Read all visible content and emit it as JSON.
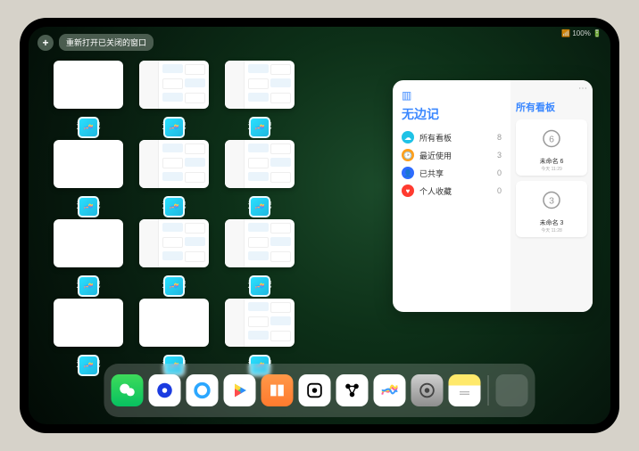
{
  "status_text": "📶 100% 🔋",
  "buttons": {
    "plus": "+",
    "reopen": "重新打开已关闭的窗口"
  },
  "app_name": "无边记",
  "windows": [
    {
      "label": "无边记",
      "style": "blank"
    },
    {
      "label": "无边记",
      "style": "grid"
    },
    {
      "label": "无边记",
      "style": "grid"
    },
    {
      "label": "无边记",
      "style": "blank"
    },
    {
      "label": "无边记",
      "style": "grid"
    },
    {
      "label": "无边记",
      "style": "grid"
    },
    {
      "label": "无边记",
      "style": "blank"
    },
    {
      "label": "无边记",
      "style": "grid"
    },
    {
      "label": "无边记",
      "style": "grid"
    },
    {
      "label": "无边记",
      "style": "blank"
    },
    {
      "label": "无边记",
      "style": "blank"
    },
    {
      "label": "无边记",
      "style": "grid"
    }
  ],
  "sidepanel": {
    "title": "无边记",
    "right_title": "所有看板",
    "items": [
      {
        "icon_color": "#1fc2e6",
        "label": "所有看板",
        "count": 8
      },
      {
        "icon_color": "#ff9f1c",
        "label": "最近使用",
        "count": 3
      },
      {
        "icon_color": "#2e6cff",
        "label": "已共享",
        "count": 0
      },
      {
        "icon_color": "#ff3b30",
        "label": "个人收藏",
        "count": 0
      }
    ],
    "boards": [
      {
        "label": "未命名 6",
        "date": "今天 11:29",
        "digit": "6"
      },
      {
        "label": "未命名 3",
        "date": "今天 11:28",
        "digit": "3"
      }
    ]
  },
  "dock": [
    {
      "name": "wechat",
      "bg": "linear-gradient(180deg,#3ddb5a,#07c160)"
    },
    {
      "name": "app-blue-circle",
      "bg": "#fff"
    },
    {
      "name": "quark",
      "bg": "#fff"
    },
    {
      "name": "play",
      "bg": "#fff"
    },
    {
      "name": "books",
      "bg": "linear-gradient(180deg,#ff9848,#ff7a2e)"
    },
    {
      "name": "dice",
      "bg": "#fff"
    },
    {
      "name": "nodes",
      "bg": "#fff"
    },
    {
      "name": "freeform",
      "bg": "#fff"
    },
    {
      "name": "settings",
      "bg": "linear-gradient(180deg,#cfcfcf,#8e8e8e)"
    },
    {
      "name": "notes",
      "bg": "linear-gradient(180deg,#ffe96b 35%,#fff 35%)"
    }
  ]
}
